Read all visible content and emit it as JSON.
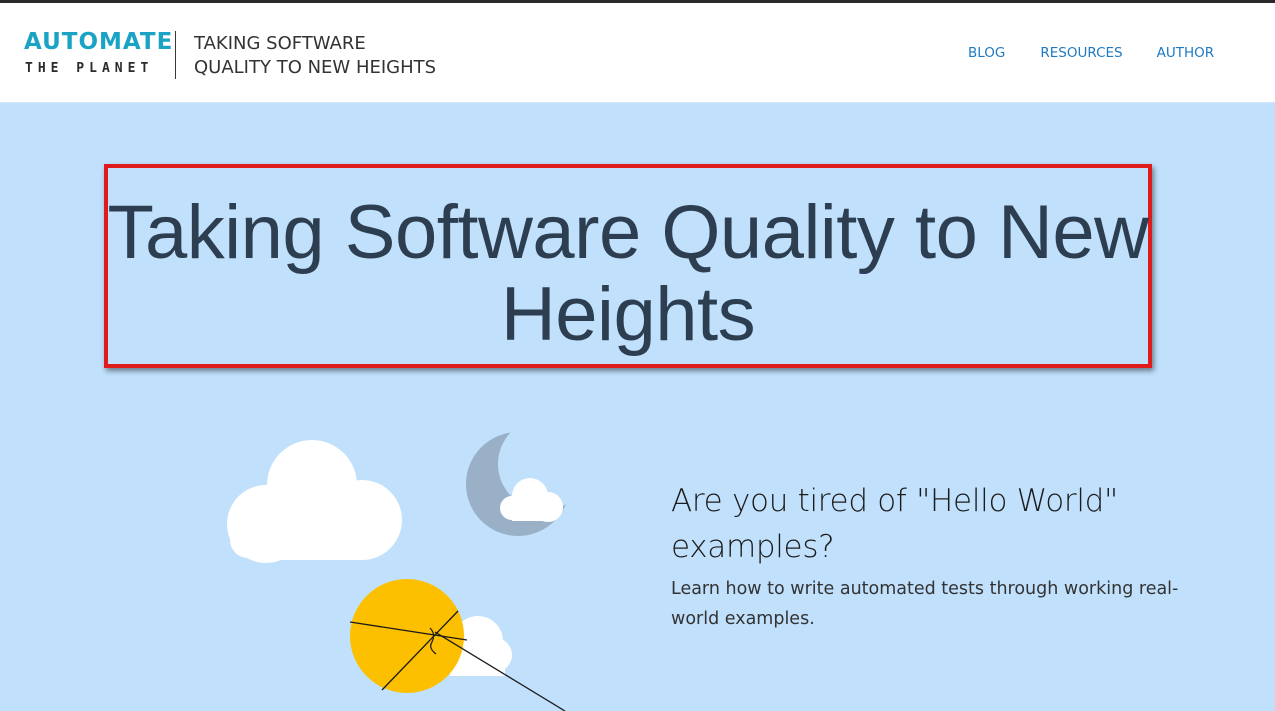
{
  "header": {
    "logo": {
      "line1": "AUTOMATE",
      "line2": "THE PLANET"
    },
    "tagline": {
      "line1": "TAKING SOFTWARE",
      "line2": "QUALITY TO NEW HEIGHTS"
    },
    "nav": [
      {
        "label": "BLOG"
      },
      {
        "label": "RESOURCES"
      },
      {
        "label": "AUTHOR"
      }
    ]
  },
  "hero": {
    "title": "Taking Software Quality to New Heights",
    "highlight_color": "#e01b1b"
  },
  "pitch": {
    "heading": "Are you tired of \"Hello World\" examples?",
    "subheading": "Learn how to write automated tests through working real-world examples."
  },
  "colors": {
    "background": "#c0e0fc",
    "accent": "#1ba3c6",
    "nav": "#1f7ac2",
    "sun": "#fcc000",
    "moon": "#9ab0c6",
    "cloud": "#ffffff"
  },
  "icons": [
    "cloud-icon",
    "moon-icon",
    "kite-sun-icon"
  ]
}
